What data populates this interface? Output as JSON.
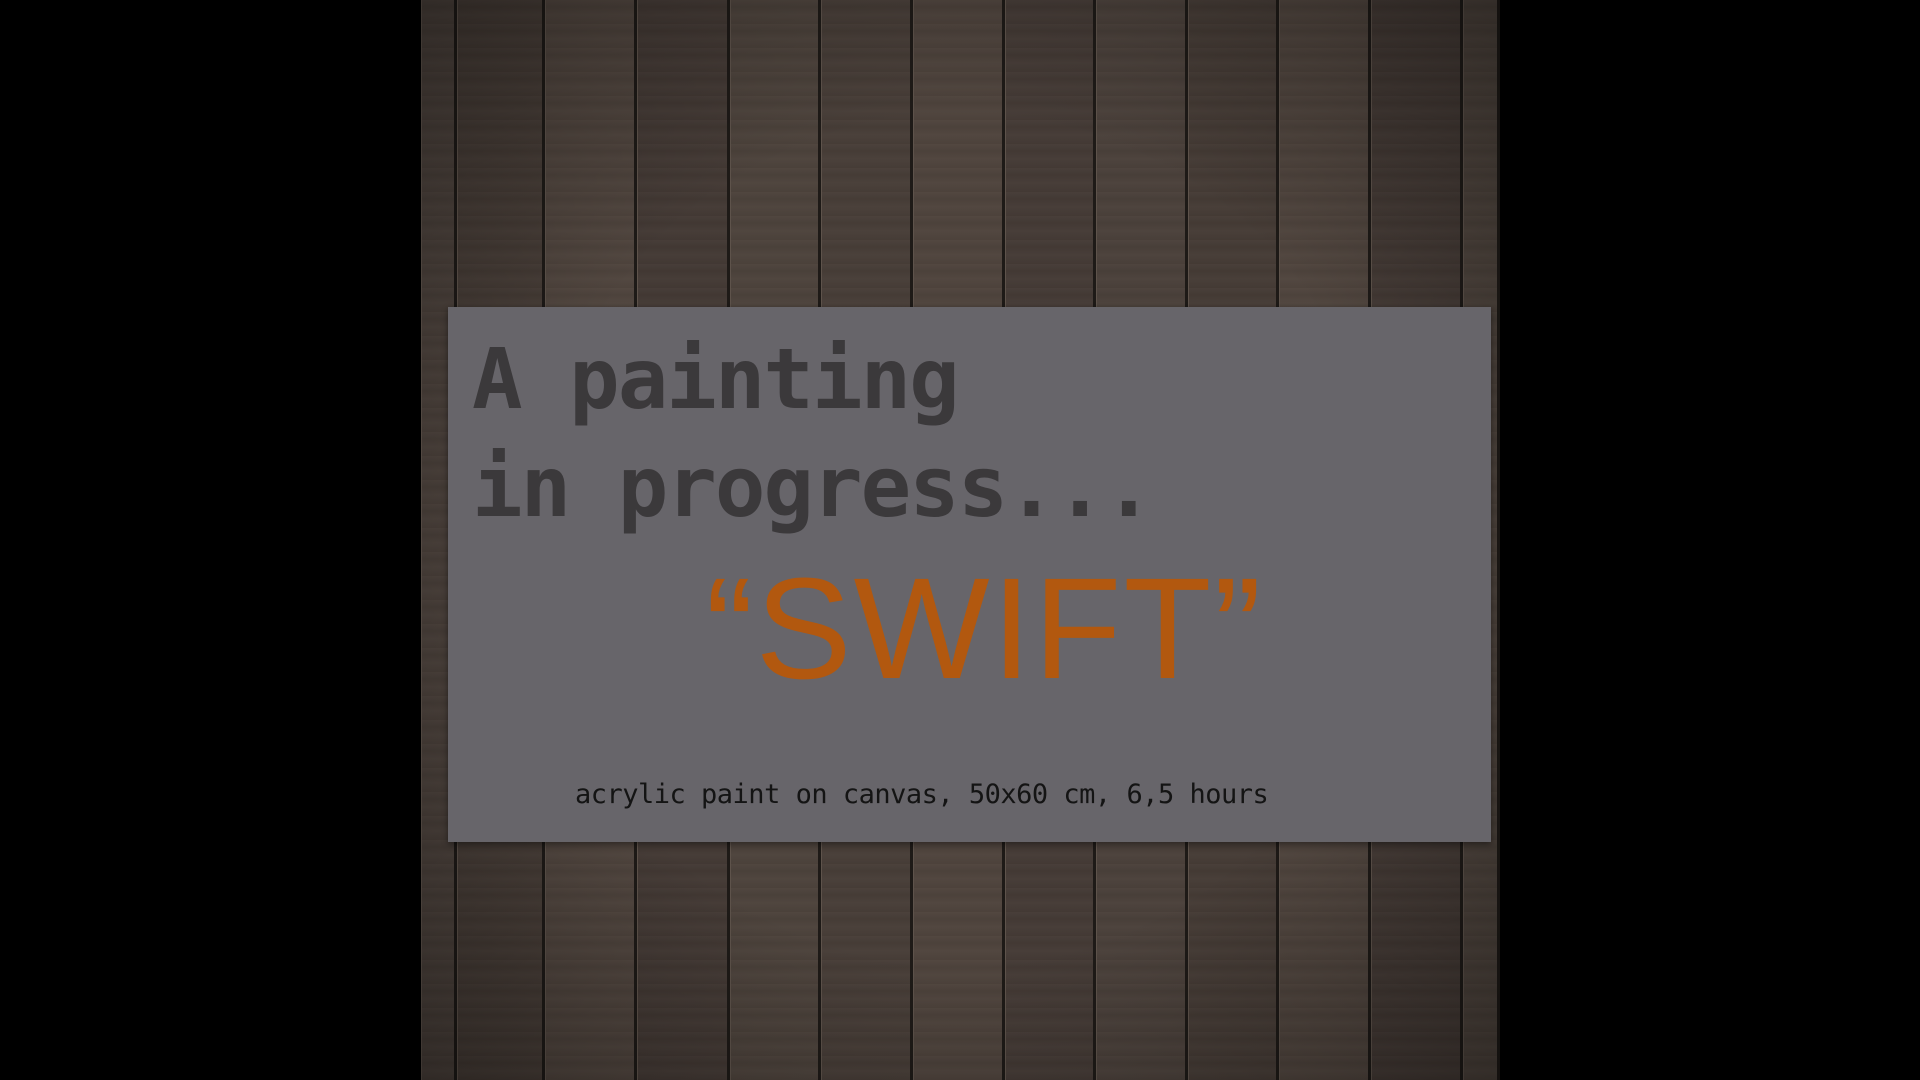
{
  "card": {
    "heading_line1": "A painting",
    "heading_line2": "in progress...",
    "artwork_title": "“SWIFT”",
    "caption": "acrylic paint on canvas,  50x60 cm,  6,5 hours"
  },
  "colors": {
    "background": "#000000",
    "wood": "#4a403a",
    "card": "#67656a",
    "heading_text": "#3b393b",
    "title_accent": "#b2580f",
    "caption_text": "#141414"
  }
}
